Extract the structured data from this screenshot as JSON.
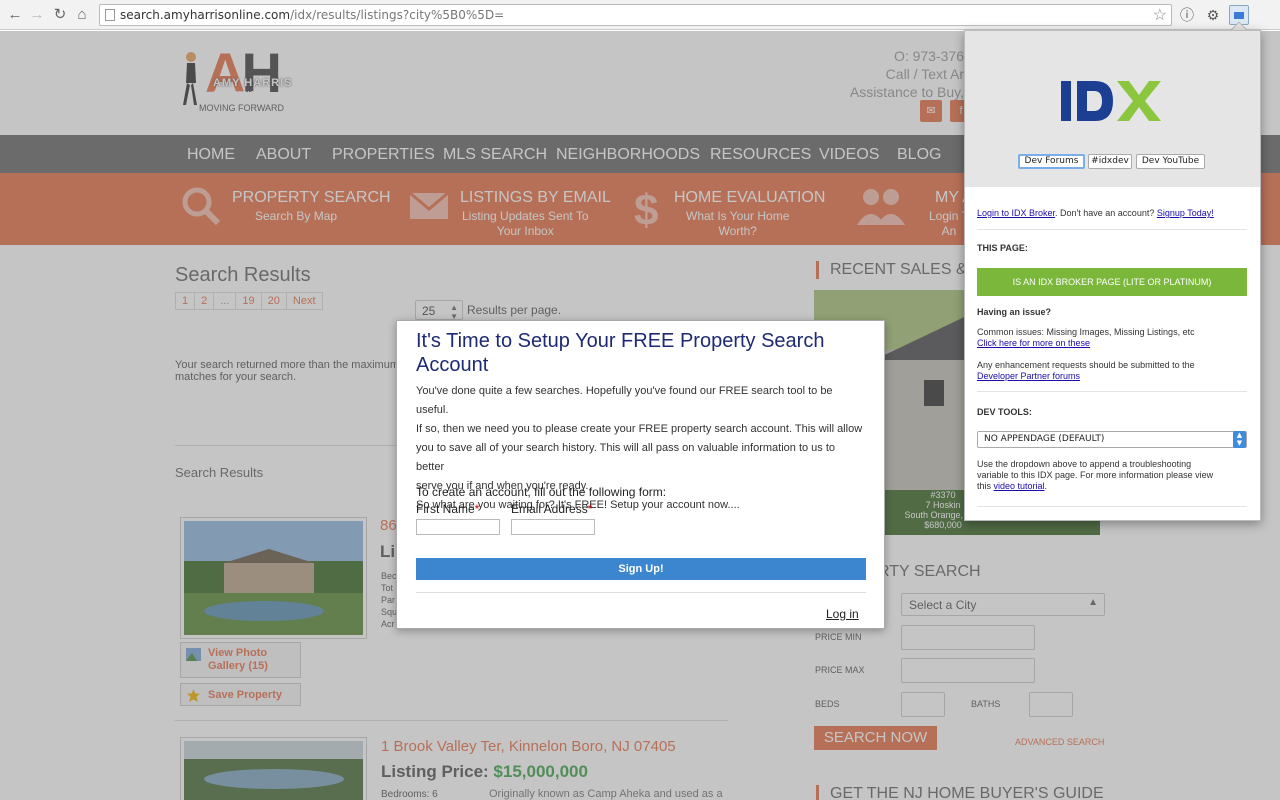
{
  "browser": {
    "url_host": "search.amyharrisonline.com",
    "url_path": "/idx/results/listings?city%5B0%5D="
  },
  "header": {
    "logo_name": "AMY HARRIS",
    "logo_sub": "REAL ESTATE",
    "logo_tag": "MOVING FORWARD",
    "phone": "O: 973-376",
    "call_text": "Call / Text Ar",
    "assist": "Assistance to Buy, "
  },
  "nav": [
    "HOME",
    "ABOUT",
    "PROPERTIES",
    "MLS SEARCH",
    "NEIGHBORHOODS",
    "RESOURCES",
    "VIDEOS",
    "BLOG"
  ],
  "features": [
    {
      "title": "PROPERTY SEARCH",
      "sub": "Search By Map",
      "icon": "search-icon"
    },
    {
      "title": "LISTINGS BY EMAIL",
      "sub": "Listing Updates Sent To\nYour Inbox",
      "icon": "envelope-icon"
    },
    {
      "title": "HOME EVALUATION",
      "sub": "What Is Your Home\nWorth?",
      "icon": "dollar-icon"
    },
    {
      "title": "MY A",
      "sub": "Login T\nAn",
      "icon": "users-icon"
    }
  ],
  "results": {
    "heading": "Search Results",
    "pages": [
      "1",
      "2",
      "...",
      "19",
      "20",
      "Next"
    ],
    "per_page_value": "25",
    "per_page_label": "Results per page.",
    "returned_text": "Your search returned more than the maximum matches for your search.",
    "sub_heading": "Search Results",
    "listing1_addr_peek": "86",
    "listing1_price_peek": "Lis",
    "listing1_side": [
      "Bec",
      "Tot",
      "Par",
      "Squ",
      "Acr"
    ],
    "gallery_label": "View Photo Gallery (15)",
    "save_label": "Save Property",
    "listing2_address": "1 Brook Valley Ter, Kinnelon Boro, NJ 07405",
    "listing2_price_label": "Listing Price: ",
    "listing2_price": "$15,000,000",
    "listing2_beds": "Bedrooms: 6",
    "listing2_desc": "Originally known as Camp Aheka and used as a"
  },
  "sidebar": {
    "recent_heading": "RECENT SALES & L",
    "caption": [
      "#3370",
      "7 Hoskin",
      "South Orange, Nev",
      "$680,000"
    ],
    "search_heading": "RTY SEARCH",
    "city_placeholder": "Select a City",
    "price_min": "PRICE MIN",
    "price_max": "PRICE MAX",
    "beds": "BEDS",
    "baths": "BATHS",
    "search_now": "SEARCH NOW",
    "advanced": "ADVANCED SEARCH",
    "guide_heading": "GET THE NJ HOME BUYER'S GUIDE"
  },
  "modal": {
    "title": "It's Time to Setup Your FREE Property Search Account",
    "body_lines": [
      "You've done quite a few searches. Hopefully you've found our FREE search tool to be useful.",
      "If so, then we need you to please create your FREE property search account. This will allow",
      "you to save all of your search history. This will all pass on valuable information to us to better",
      "serve you if and when you're ready.",
      "So what are you waiting for? It's FREE! Setup your account now...."
    ],
    "form_heading": "To create an account, fill out the following form:",
    "first_name": "First Name",
    "email": "Email Address",
    "required_mark": "*",
    "signup": "Sign Up!",
    "login": "Log in"
  },
  "popup": {
    "logo_text": "IDX",
    "btn_forums": "Dev Forums",
    "btn_idxdev": "#idxdev",
    "btn_youtube": "Dev YouTube",
    "login_link": "Login to IDX Broker",
    "login_rest": ". Don't have an account? ",
    "signup_link": "Signup Today!",
    "this_page": "THIS PAGE:",
    "status_btn": "IS AN IDX BROKER PAGE (LITE OR PLATINUM)",
    "issue_head": "Having an issue?",
    "common": "Common issues: Missing Images, Missing Listings, etc",
    "click_here": "Click here for more on these",
    "enh": "Any enhancement requests should be submitted to the",
    "dev_forums_link": "Developer Partner forums",
    "dev_tools": "DEV TOOLS:",
    "select_value": "NO APPENDAGE (DEFAULT)",
    "use_text_1": "Use the dropdown above to append a troubleshooting",
    "use_text_2": "variable to this IDX page. For more information please view",
    "use_text_3": "this ",
    "video_link": "video tutorial",
    "colors": {
      "idx_blue": "#1c3f94",
      "idx_green": "#8cc63f",
      "status_green": "#7ab73b"
    }
  }
}
